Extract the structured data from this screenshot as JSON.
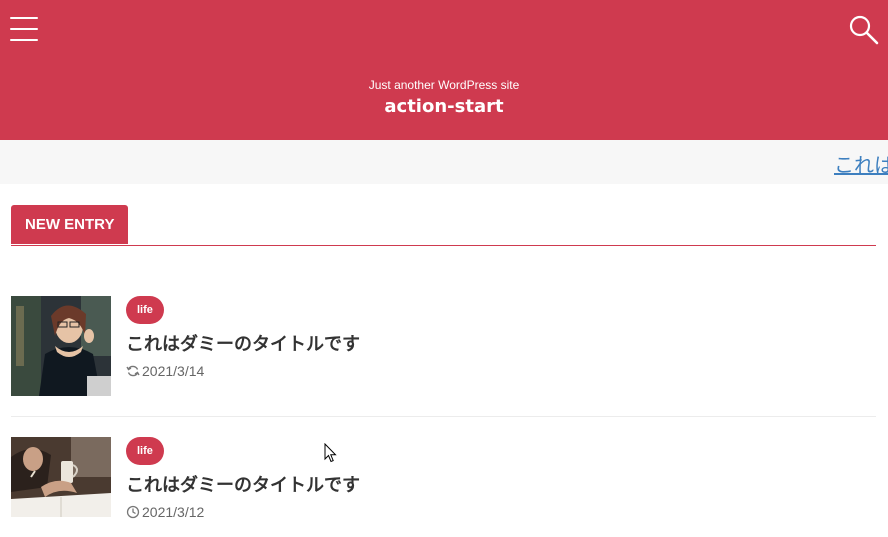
{
  "header": {
    "tagline": "Just another WordPress site",
    "title": "action-start",
    "menu_icon": "hamburger-menu-icon",
    "search_icon": "search-icon"
  },
  "ticker": {
    "text": "これはダミーのタイトルです"
  },
  "section": {
    "label": "NEW ENTRY"
  },
  "entries": [
    {
      "category": "life",
      "title": "これはダミーのタイトルです",
      "date": "2021/3/14",
      "date_icon": "refresh-icon"
    },
    {
      "category": "life",
      "title": "これはダミーのタイトルです",
      "date": "2021/3/12",
      "date_icon": "clock-icon"
    }
  ],
  "colors": {
    "accent": "#cf3a4f",
    "ticker_bg": "#f7f7f7",
    "link": "#3d7fbf",
    "text": "#333333"
  }
}
